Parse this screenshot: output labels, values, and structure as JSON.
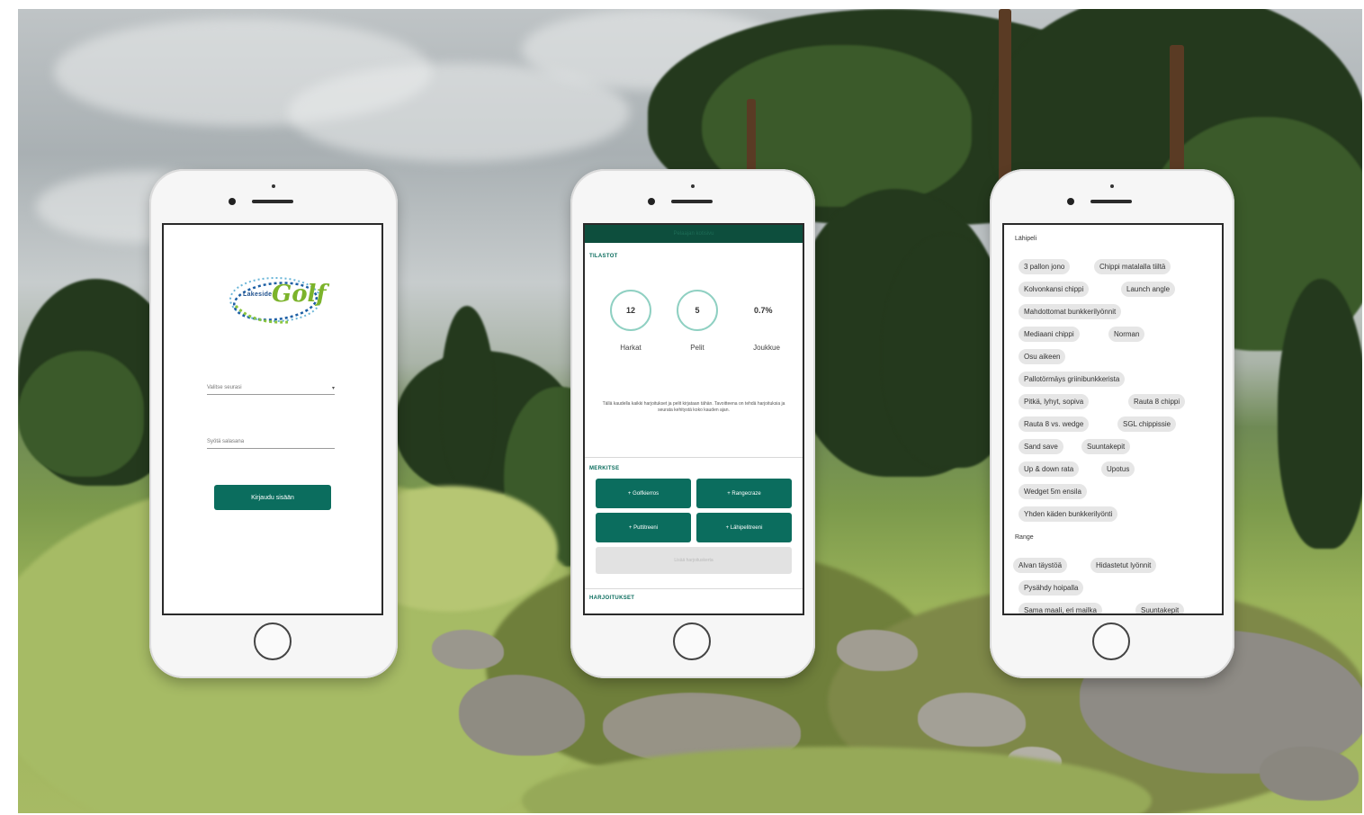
{
  "login": {
    "logo_prefix": "Lakeside",
    "logo_word": "Golf",
    "club_select_placeholder": "Valitse seurasi",
    "password_placeholder": "Syötä salasana",
    "login_button": "Kirjaudu sisään"
  },
  "dashboard": {
    "header_title": "Pelaajan kotisivu",
    "stats_title": "TILASTOT",
    "stats": [
      {
        "value": "12",
        "label": "Harkat"
      },
      {
        "value": "5",
        "label": "Pelit"
      },
      {
        "value": "0.7%",
        "label": "Joukkue"
      }
    ],
    "info_text": "Tällä kaudella kaikki harjoitukset ja pelit kirjataan tähän. Tavoitteena on tehdä harjoituksia ja seurata kehitystä koko kauden ajan.",
    "record_title": "MERKITSE",
    "buttons": [
      "+ Golfkierros",
      "+ Rangecraze",
      "+ Puttitreeni",
      "+ Lähipelitreeni"
    ],
    "extra_button": "Lisää harjoituskerta",
    "exercises_title": "HARJOITUKSET"
  },
  "drills": {
    "categories": [
      {
        "title": "Lähipeli",
        "chips": [
          "3 pallon jono",
          "Chippi matalalla tiiltä",
          "Kolvonkansi chippi",
          "Launch angle",
          "Mahdottomat bunkkerilyönnit",
          "Mediaani chippi",
          "Norman",
          "Osu aikeen",
          "Pallotörmäys griinibunkkerista",
          "Pitkä, lyhyt, sopiva",
          "Rauta 8 chippi",
          "Rauta 8 vs. wedge",
          "SGL chippissie",
          "Sand save",
          "Suuntakepit",
          "Up & down rata",
          "Upotus",
          "Wedget 5m ensila",
          "Yhden käden bunkkerilyönti"
        ]
      },
      {
        "title": "Range",
        "chips": [
          "Alvan täystöä",
          "Hidastetut lyönnit",
          "Pysähdy hoipalla",
          "Sama maali, eri mailka",
          "Suuntakepit"
        ]
      }
    ]
  }
}
